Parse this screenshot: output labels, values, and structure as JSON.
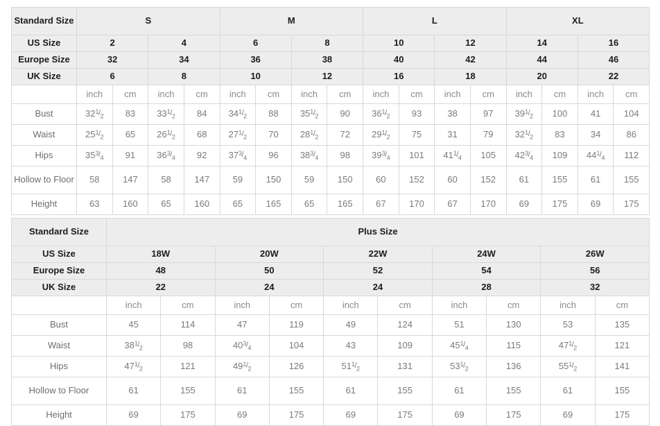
{
  "standard_table": {
    "row_labels": {
      "standard_size": "Standard Size",
      "us_size": "US Size",
      "europe_size": "Europe Size",
      "uk_size": "UK Size"
    },
    "size_groups": [
      {
        "label": "S",
        "span": 4
      },
      {
        "label": "M",
        "span": 4
      },
      {
        "label": "L",
        "span": 4
      },
      {
        "label": "XL",
        "span": 4
      }
    ],
    "us_sizes": [
      "2",
      "4",
      "6",
      "8",
      "10",
      "12",
      "14",
      "16"
    ],
    "europe_sizes": [
      "32",
      "34",
      "36",
      "38",
      "40",
      "42",
      "44",
      "46"
    ],
    "uk_sizes": [
      "6",
      "8",
      "10",
      "12",
      "16",
      "18",
      "20",
      "22"
    ],
    "units": [
      "inch",
      "cm",
      "inch",
      "cm",
      "inch",
      "cm",
      "inch",
      "cm",
      "inch",
      "cm",
      "inch",
      "cm",
      "inch",
      "cm",
      "inch",
      "cm"
    ],
    "measurements": [
      {
        "label": "Bust",
        "tall": false,
        "values": [
          {
            "whole": "32",
            "num": "1",
            "den": "2"
          },
          {
            "whole": "83"
          },
          {
            "whole": "33",
            "num": "1",
            "den": "2"
          },
          {
            "whole": "84"
          },
          {
            "whole": "34",
            "num": "1",
            "den": "2"
          },
          {
            "whole": "88"
          },
          {
            "whole": "35",
            "num": "1",
            "den": "2"
          },
          {
            "whole": "90"
          },
          {
            "whole": "36",
            "num": "1",
            "den": "2"
          },
          {
            "whole": "93"
          },
          {
            "whole": "38"
          },
          {
            "whole": "97"
          },
          {
            "whole": "39",
            "num": "1",
            "den": "2"
          },
          {
            "whole": "100"
          },
          {
            "whole": "41"
          },
          {
            "whole": "104"
          }
        ]
      },
      {
        "label": "Waist",
        "tall": false,
        "values": [
          {
            "whole": "25",
            "num": "1",
            "den": "2"
          },
          {
            "whole": "65"
          },
          {
            "whole": "26",
            "num": "1",
            "den": "2"
          },
          {
            "whole": "68"
          },
          {
            "whole": "27",
            "num": "1",
            "den": "2"
          },
          {
            "whole": "70"
          },
          {
            "whole": "28",
            "num": "1",
            "den": "2"
          },
          {
            "whole": "72"
          },
          {
            "whole": "29",
            "num": "1",
            "den": "2"
          },
          {
            "whole": "75"
          },
          {
            "whole": "31"
          },
          {
            "whole": "79"
          },
          {
            "whole": "32",
            "num": "1",
            "den": "2"
          },
          {
            "whole": "83"
          },
          {
            "whole": "34"
          },
          {
            "whole": "86"
          }
        ]
      },
      {
        "label": "Hips",
        "tall": false,
        "values": [
          {
            "whole": "35",
            "num": "3",
            "den": "4"
          },
          {
            "whole": "91"
          },
          {
            "whole": "36",
            "num": "3",
            "den": "4"
          },
          {
            "whole": "92"
          },
          {
            "whole": "37",
            "num": "3",
            "den": "4"
          },
          {
            "whole": "96"
          },
          {
            "whole": "38",
            "num": "3",
            "den": "4"
          },
          {
            "whole": "98"
          },
          {
            "whole": "39",
            "num": "3",
            "den": "4"
          },
          {
            "whole": "101"
          },
          {
            "whole": "41",
            "num": "1",
            "den": "4"
          },
          {
            "whole": "105"
          },
          {
            "whole": "42",
            "num": "3",
            "den": "4"
          },
          {
            "whole": "109"
          },
          {
            "whole": "44",
            "num": "1",
            "den": "4"
          },
          {
            "whole": "112"
          }
        ]
      },
      {
        "label": "Hollow to Floor",
        "tall": true,
        "values": [
          {
            "whole": "58"
          },
          {
            "whole": "147"
          },
          {
            "whole": "58"
          },
          {
            "whole": "147"
          },
          {
            "whole": "59"
          },
          {
            "whole": "150"
          },
          {
            "whole": "59"
          },
          {
            "whole": "150"
          },
          {
            "whole": "60"
          },
          {
            "whole": "152"
          },
          {
            "whole": "60"
          },
          {
            "whole": "152"
          },
          {
            "whole": "61"
          },
          {
            "whole": "155"
          },
          {
            "whole": "61"
          },
          {
            "whole": "155"
          }
        ]
      },
      {
        "label": "Height",
        "tall": false,
        "values": [
          {
            "whole": "63"
          },
          {
            "whole": "160"
          },
          {
            "whole": "65"
          },
          {
            "whole": "160"
          },
          {
            "whole": "65"
          },
          {
            "whole": "165"
          },
          {
            "whole": "65"
          },
          {
            "whole": "165"
          },
          {
            "whole": "67"
          },
          {
            "whole": "170"
          },
          {
            "whole": "67"
          },
          {
            "whole": "170"
          },
          {
            "whole": "69"
          },
          {
            "whole": "175"
          },
          {
            "whole": "69"
          },
          {
            "whole": "175"
          }
        ]
      }
    ]
  },
  "plus_table": {
    "row_labels": {
      "standard_size": "Standard Size",
      "us_size": "US Size",
      "europe_size": "Europe Size",
      "uk_size": "UK Size"
    },
    "group_title": "Plus Size",
    "us_sizes": [
      "18W",
      "20W",
      "22W",
      "24W",
      "26W"
    ],
    "europe_sizes": [
      "48",
      "50",
      "52",
      "54",
      "56"
    ],
    "uk_sizes": [
      "22",
      "24",
      "24",
      "28",
      "32"
    ],
    "units": [
      "inch",
      "cm",
      "inch",
      "cm",
      "inch",
      "cm",
      "inch",
      "cm",
      "inch",
      "cm"
    ],
    "measurements": [
      {
        "label": "Bust",
        "tall": false,
        "values": [
          {
            "whole": "45"
          },
          {
            "whole": "114"
          },
          {
            "whole": "47"
          },
          {
            "whole": "119"
          },
          {
            "whole": "49"
          },
          {
            "whole": "124"
          },
          {
            "whole": "51"
          },
          {
            "whole": "130"
          },
          {
            "whole": "53"
          },
          {
            "whole": "135"
          }
        ]
      },
      {
        "label": "Waist",
        "tall": false,
        "values": [
          {
            "whole": "38",
            "num": "1",
            "den": "2"
          },
          {
            "whole": "98"
          },
          {
            "whole": "40",
            "num": "3",
            "den": "4"
          },
          {
            "whole": "104"
          },
          {
            "whole": "43"
          },
          {
            "whole": "109"
          },
          {
            "whole": "45",
            "num": "1",
            "den": "4"
          },
          {
            "whole": "115"
          },
          {
            "whole": "47",
            "num": "1",
            "den": "2"
          },
          {
            "whole": "121"
          }
        ]
      },
      {
        "label": "Hips",
        "tall": false,
        "values": [
          {
            "whole": "47",
            "num": "1",
            "den": "2"
          },
          {
            "whole": "121"
          },
          {
            "whole": "49",
            "num": "1",
            "den": "2"
          },
          {
            "whole": "126"
          },
          {
            "whole": "51",
            "num": "1",
            "den": "2"
          },
          {
            "whole": "131"
          },
          {
            "whole": "53",
            "num": "1",
            "den": "2"
          },
          {
            "whole": "136"
          },
          {
            "whole": "55",
            "num": "1",
            "den": "2"
          },
          {
            "whole": "141"
          }
        ]
      },
      {
        "label": "Hollow to Floor",
        "tall": true,
        "values": [
          {
            "whole": "61"
          },
          {
            "whole": "155"
          },
          {
            "whole": "61"
          },
          {
            "whole": "155"
          },
          {
            "whole": "61"
          },
          {
            "whole": "155"
          },
          {
            "whole": "61"
          },
          {
            "whole": "155"
          },
          {
            "whole": "61"
          },
          {
            "whole": "155"
          }
        ]
      },
      {
        "label": "Height",
        "tall": false,
        "values": [
          {
            "whole": "69"
          },
          {
            "whole": "175"
          },
          {
            "whole": "69"
          },
          {
            "whole": "175"
          },
          {
            "whole": "69"
          },
          {
            "whole": "175"
          },
          {
            "whole": "69"
          },
          {
            "whole": "175"
          },
          {
            "whole": "69"
          },
          {
            "whole": "175"
          }
        ]
      }
    ]
  }
}
